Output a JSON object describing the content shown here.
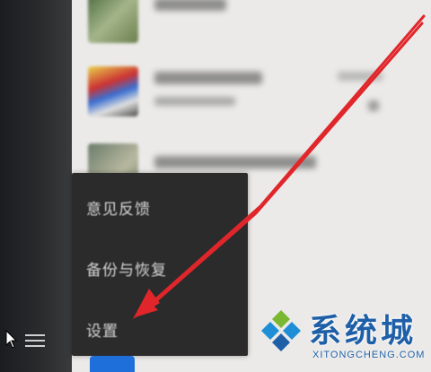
{
  "context_menu": {
    "items": [
      {
        "label": "意见反馈"
      },
      {
        "label": "备份与恢复"
      },
      {
        "label": "设置"
      }
    ]
  },
  "icons": {
    "cursor": "cursor-icon",
    "menu": "hamburger-menu-icon",
    "bottom_app": "app-icon"
  },
  "watermark": {
    "title": "系统城",
    "subtitle": "XITONGCHENG.COM"
  },
  "colors": {
    "arrow": "#e0262b",
    "menu_bg": "#2b2b2b",
    "watermark_blue": "#1e5fa8",
    "watermark_green": "#7ab832"
  }
}
